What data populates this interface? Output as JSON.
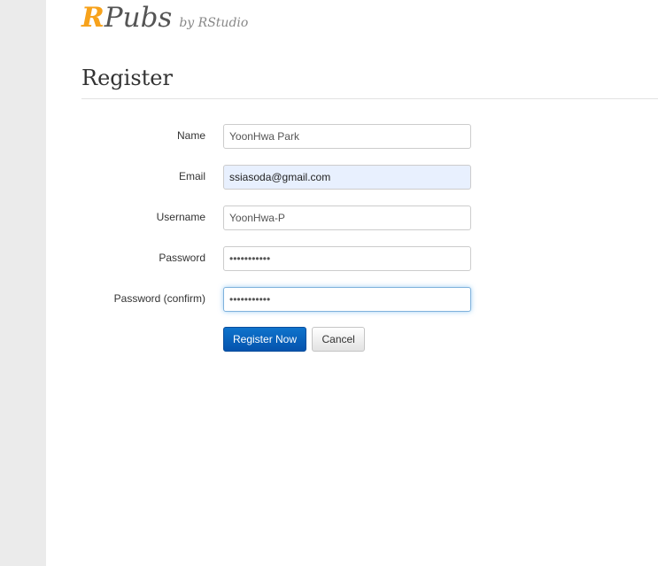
{
  "header": {
    "brand_r": "R",
    "brand_pubs": "Pubs",
    "brand_by": "by RStudio"
  },
  "page_title": "Register",
  "form": {
    "fields": [
      {
        "label": "Name",
        "value": "YoonHwa Park"
      },
      {
        "label": "Email",
        "value": "ssiasoda@gmail.com"
      },
      {
        "label": "Username",
        "value": "YoonHwa-P"
      },
      {
        "label": "Password",
        "value": "•••••••••••"
      },
      {
        "label": "Password (confirm)",
        "value": "•••••••••••"
      }
    ],
    "register_label": "Register Now",
    "cancel_label": "Cancel"
  },
  "colors": {
    "brand_accent": "#f7a21b",
    "primary_button": "#0e73cc",
    "autofill_bg": "#e8f0fe",
    "gutter": "#ebebeb"
  }
}
